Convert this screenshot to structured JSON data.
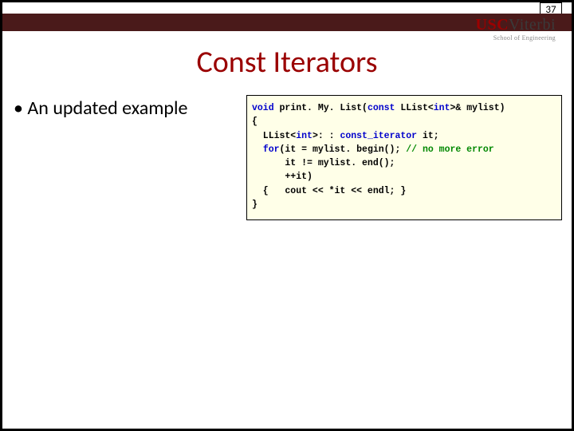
{
  "page_number": "37",
  "logo": {
    "usc": "USC",
    "viterbi": "Viterbi",
    "sub": "School of Engineering"
  },
  "title": "Const Iterators",
  "bullet_text": "An updated example",
  "code": {
    "l1a": "void",
    "l1b": " print. My. List(",
    "l1c": "const",
    "l1d": " LList<",
    "l1e": "int",
    "l1f": ">& mylist)",
    "l2": "{",
    "l3a": "  LList<",
    "l3b": "int",
    "l3c": ">: : ",
    "l3d": "const_iterator",
    "l3e": " it;",
    "l4a": "  ",
    "l4b": "for",
    "l4c": "(it = mylist. begin(); ",
    "l4d": "// no more error",
    "l5": "      it != mylist. end();",
    "l6": "      ++it)",
    "l7": "  {   cout << *it << endl; }",
    "l8": "}"
  }
}
